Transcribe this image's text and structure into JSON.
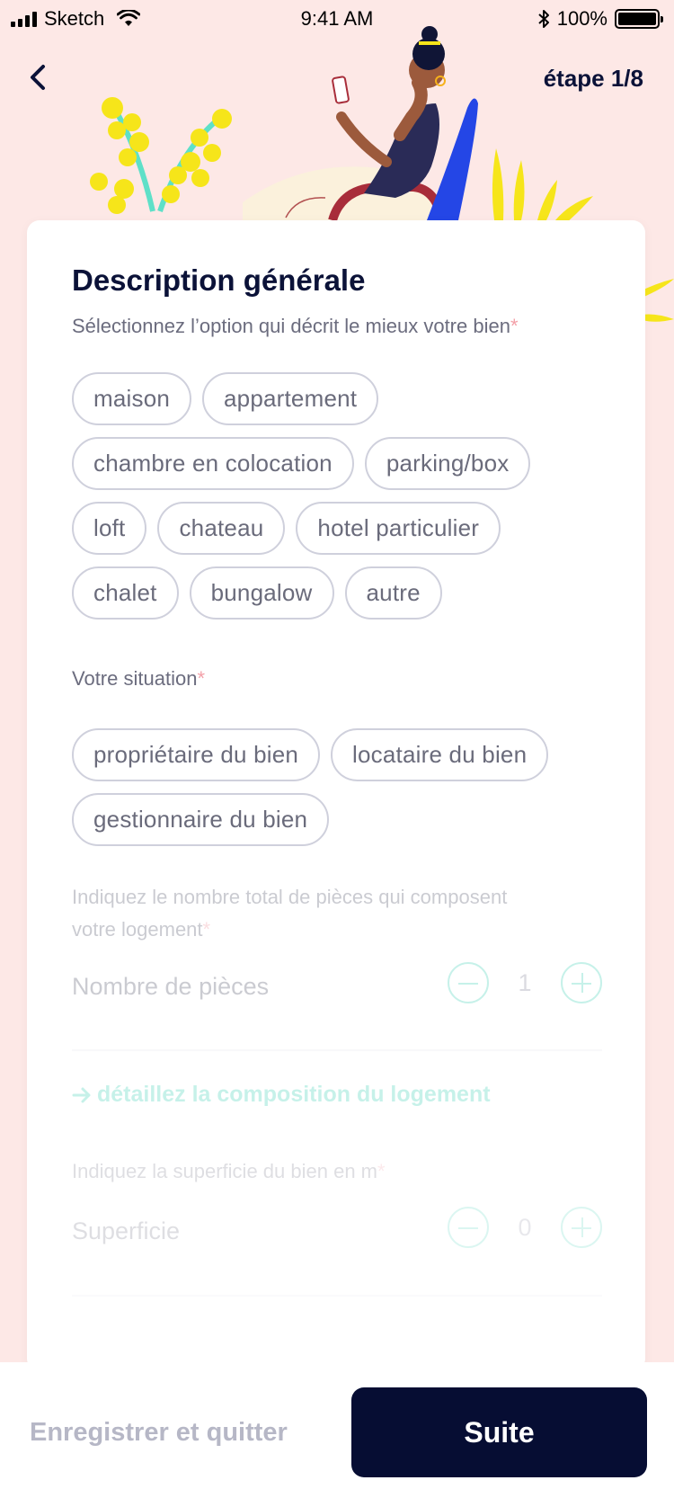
{
  "status_bar": {
    "carrier": "Sketch",
    "time": "9:41 AM",
    "battery": "100%"
  },
  "header": {
    "step": "étape 1/8"
  },
  "form": {
    "title": "Description générale",
    "property_type": {
      "label": "Sélectionnez l’option qui décrit le mieux votre bien",
      "required_mark": "*",
      "options": [
        [
          "maison",
          "appartement"
        ],
        [
          "chambre en colocation",
          "parking/box"
        ],
        [
          "loft",
          "chateau",
          "hotel particulier"
        ],
        [
          "chalet",
          "bungalow",
          "autre"
        ]
      ]
    },
    "situation": {
      "label": "Votre situation",
      "required_mark": "*",
      "options": [
        [
          "propriétaire du bien",
          "locataire du bien"
        ],
        [
          "gestionnaire du bien"
        ]
      ]
    },
    "rooms": {
      "label_line1": "Indiquez le nombre total de pièces qui composent",
      "label_line2": "votre logement",
      "required_mark": "*",
      "field_label": "Nombre de pièces",
      "value": "1"
    },
    "detail_link": "détaillez la composition du logement",
    "surface": {
      "label": "Indiquez la superficie du bien en m",
      "required_mark": "*",
      "field_label": "Superficie",
      "value": "0"
    }
  },
  "footer": {
    "save_quit": "Enregistrer et quitter",
    "next": "Suite"
  },
  "colors": {
    "background": "#fde8e6",
    "primary_dark": "#060d33",
    "accent_teal": "#5fd8c2",
    "required_pink": "#f3a0a8"
  }
}
